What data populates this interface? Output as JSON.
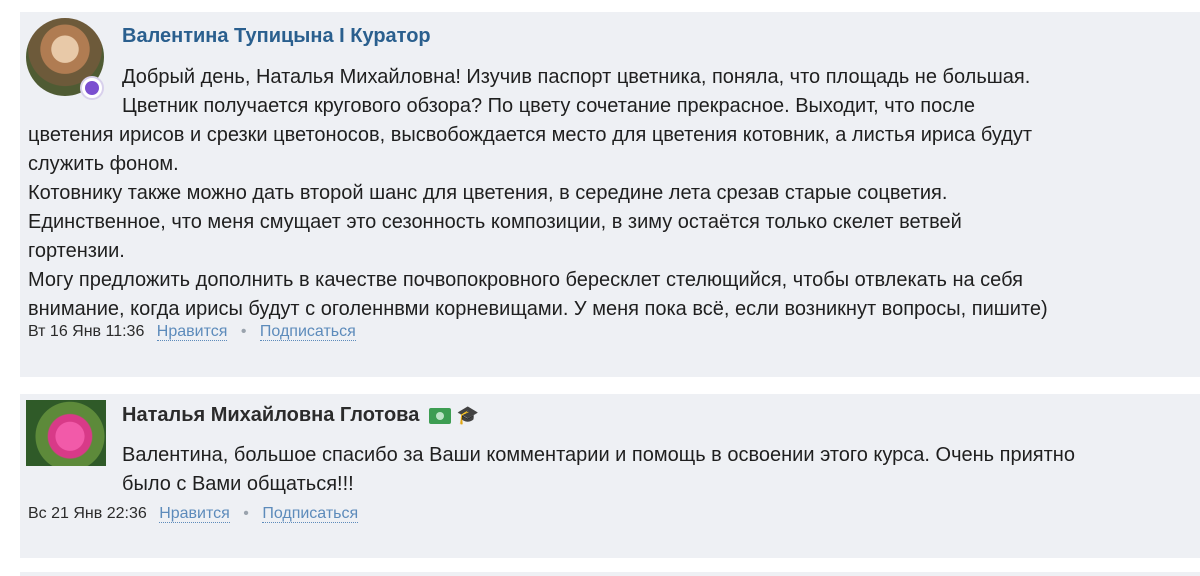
{
  "comments": [
    {
      "author": "Валентина Тупицына I Куратор",
      "lines": [
        "Добрый день, Наталья Михайловна! Изучив паспорт цветника, поняла, что площадь не большая.",
        "Цветник получается кругового обзора? По цвету сочетание прекрасное. Выходит, что после",
        "цветения ирисов и срезки цветоносов, высвобождается место для цветения котовник, а листья ириса будут",
        "служить фоном.",
        "Котовнику также можно дать второй шанс для цветения, в середине лета срезав старые соцветия.",
        "Единственное, что меня смущает это сезонность композиции, в зиму остаётся только скелет ветвей",
        "гортензии.",
        "Могу предложить дополнить в качестве почвопокровного бересклет стелющийся, чтобы отвлекать на себя",
        "внимание, когда ирисы будут с оголеннвми корневищами. У меня пока всё, если возникнут вопросы, пишите)"
      ],
      "date": "Вт 16 Янв 11:36",
      "like": "Нравится",
      "subscribe": "Подписаться"
    },
    {
      "author": "Наталья Михайловна Глотова",
      "badge_icons": [
        "money-icon",
        "graduation-cap-icon"
      ],
      "lines": [
        "Валентина, большое спасибо за Ваши комментарии и помощь в освоении этого курса. Очень приятно",
        "было с Вами общаться!!!"
      ],
      "date": "Вс 21 Янв 22:36",
      "like": "Нравится",
      "subscribe": "Подписаться"
    }
  ],
  "colors": {
    "card_bg": "#eef0f4",
    "curator_name": "#2a5f8e",
    "link": "#5d8bbb"
  }
}
